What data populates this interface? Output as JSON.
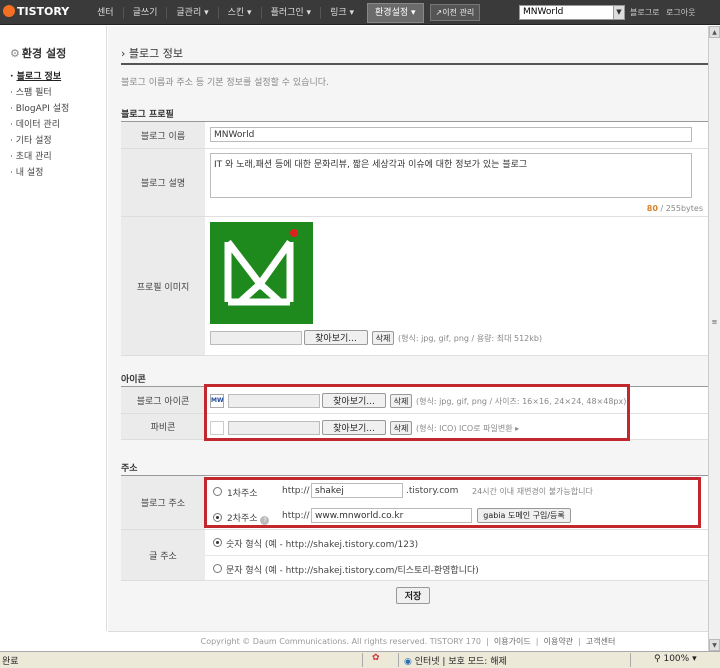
{
  "topbar": {
    "logo": "TISTORY",
    "nav": [
      "센터",
      "글쓰기",
      "글관리 ▾",
      "스킨 ▾",
      "플러그인 ▾",
      "링크 ▾"
    ],
    "active_nav": "환경설정 ▾",
    "prev_admin": "↗이전 관리",
    "blog_select": "MNWorld",
    "links": [
      "블로그로",
      "로그아웃"
    ]
  },
  "sidebar": {
    "title": "환경 설정",
    "items": [
      "블로그 정보",
      "스팸 필터",
      "BlogAPI 설정",
      "데이터 관리",
      "기타 설정",
      "초대 관리",
      "내 설정"
    ]
  },
  "main": {
    "title": "블로그 정보",
    "description": "블로그 이름과 주소 등 기본 정보를 설정할 수 있습니다.",
    "profile": {
      "section": "블로그 프로필",
      "name_label": "블로그 이름",
      "name_value": "MNWorld",
      "desc_label": "블로그 설명",
      "desc_value": "IT 와 노래,패션 등에 대한 문화리뷰, 짧은 세상각과 이슈에 대한 정보가 있는 블로그",
      "desc_count": "80",
      "desc_limit": "/ 255bytes",
      "image_label": "프로필 이미지",
      "browse": "찾아보기...",
      "delete": "삭제",
      "image_note": "(형식: jpg, gif, png / 용량: 최대 512kb)"
    },
    "icon": {
      "section": "아이콘",
      "blog_icon_label": "블로그 아이콘",
      "blog_icon_note": "(형식: jpg, gif, png / 사이즈: 16×16, 24×24, 48×48px)",
      "favicon_label": "파비콘",
      "favicon_note": "(형식: ICO) ICO로 파일변환 ▸",
      "browse": "찾아보기...",
      "delete": "삭제",
      "icon_text": "MW"
    },
    "address": {
      "section": "주소",
      "blog_addr_label": "블로그 주소",
      "first_label": "1차주소",
      "prefix": "http://",
      "first_value": "shakej",
      "first_suffix": ".tistory.com",
      "first_note": "24시간 이내 재변경이 불가능합니다",
      "second_label": "2차주소",
      "second_value": "www.mnworld.co.kr",
      "gabia": "gabia 도메인 구입/등록",
      "post_addr_label": "글 주소",
      "opt_numeric": "숫자 형식 (예 - http://shakej.tistory.com/123)",
      "opt_text": "문자 형식 (예 - http://shakej.tistory.com/티스토리-환영합니다)"
    },
    "save": "저장"
  },
  "footer": {
    "copyright": "Copyright © Daum Communications. All rights reserved. TISTORY 170",
    "links": [
      "이용가이드",
      "이용약관",
      "고객센터"
    ]
  },
  "statusbar": {
    "left": "완료",
    "zone": "인터넷 | 보호 모드: 해제",
    "zoom": "100%"
  },
  "colors": {
    "highlight": "#c1272d",
    "profile_bg": "#1e8a1e",
    "topbar": "#3a3a3a"
  }
}
